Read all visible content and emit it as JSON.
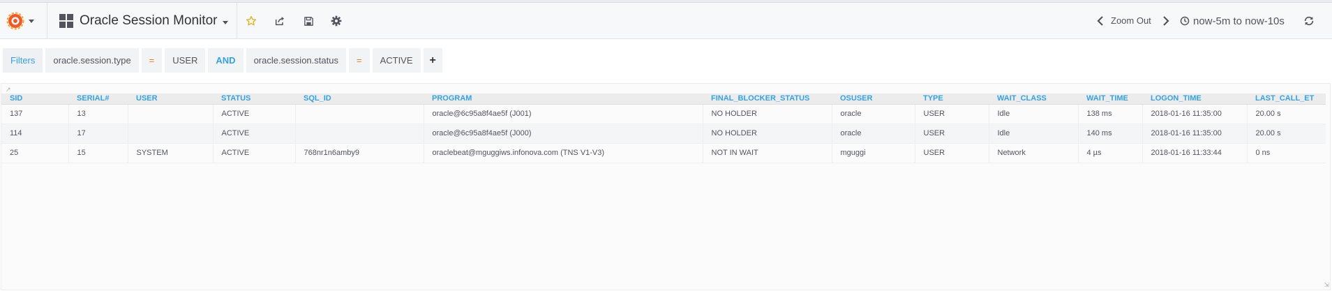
{
  "navbar": {
    "dashboard_title": "Oracle Session Monitor",
    "zoom_out_label": "Zoom Out",
    "time_range": "now-5m to now-10s",
    "icons": {
      "logo": "grafana-logo-icon",
      "dashboard": "grid-icon",
      "star": "star-icon",
      "share": "share-icon",
      "save": "save-icon",
      "settings": "gear-icon",
      "prev": "chevron-left-icon",
      "next": "chevron-right-icon",
      "clock": "clock-icon",
      "refresh": "refresh-icon"
    },
    "colors": {
      "accent": "#eb7b18",
      "star": "#e2b215"
    }
  },
  "filters": {
    "label": "Filters",
    "items": [
      {
        "key": "oracle.session.type",
        "operator": "=",
        "value": "USER"
      },
      {
        "key": "oracle.session.status",
        "operator": "=",
        "value": "ACTIVE"
      }
    ],
    "conjunction": "AND",
    "add_label": "+"
  },
  "table": {
    "columns": [
      "SID",
      "SERIAL#",
      "USER",
      "STATUS",
      "SQL_ID",
      "PROGRAM",
      "FINAL_BLOCKER_STATUS",
      "OSUSER",
      "TYPE",
      "WAIT_CLASS",
      "WAIT_TIME",
      "LOGON_TIME",
      "LAST_CALL_ET"
    ],
    "rows": [
      [
        "137",
        "13",
        "",
        "ACTIVE",
        "",
        "oracle@6c95a8f4ae5f (J001)",
        "NO HOLDER",
        "oracle",
        "USER",
        "Idle",
        "138 ms",
        "2018-01-16 11:35:00",
        "20.00 s"
      ],
      [
        "114",
        "17",
        "",
        "ACTIVE",
        "",
        "oracle@6c95a8f4ae5f (J000)",
        "NO HOLDER",
        "oracle",
        "USER",
        "Idle",
        "140 ms",
        "2018-01-16 11:35:00",
        "20.00 s"
      ],
      [
        "25",
        "15",
        "SYSTEM",
        "ACTIVE",
        "768nr1n6amby9",
        "oraclebeat@mguggiws.infonova.com (TNS V1-V3)",
        "NOT IN WAIT",
        "mguggi",
        "USER",
        "Network",
        "4 µs",
        "2018-01-16 11:33:44",
        "0 ns"
      ]
    ]
  }
}
